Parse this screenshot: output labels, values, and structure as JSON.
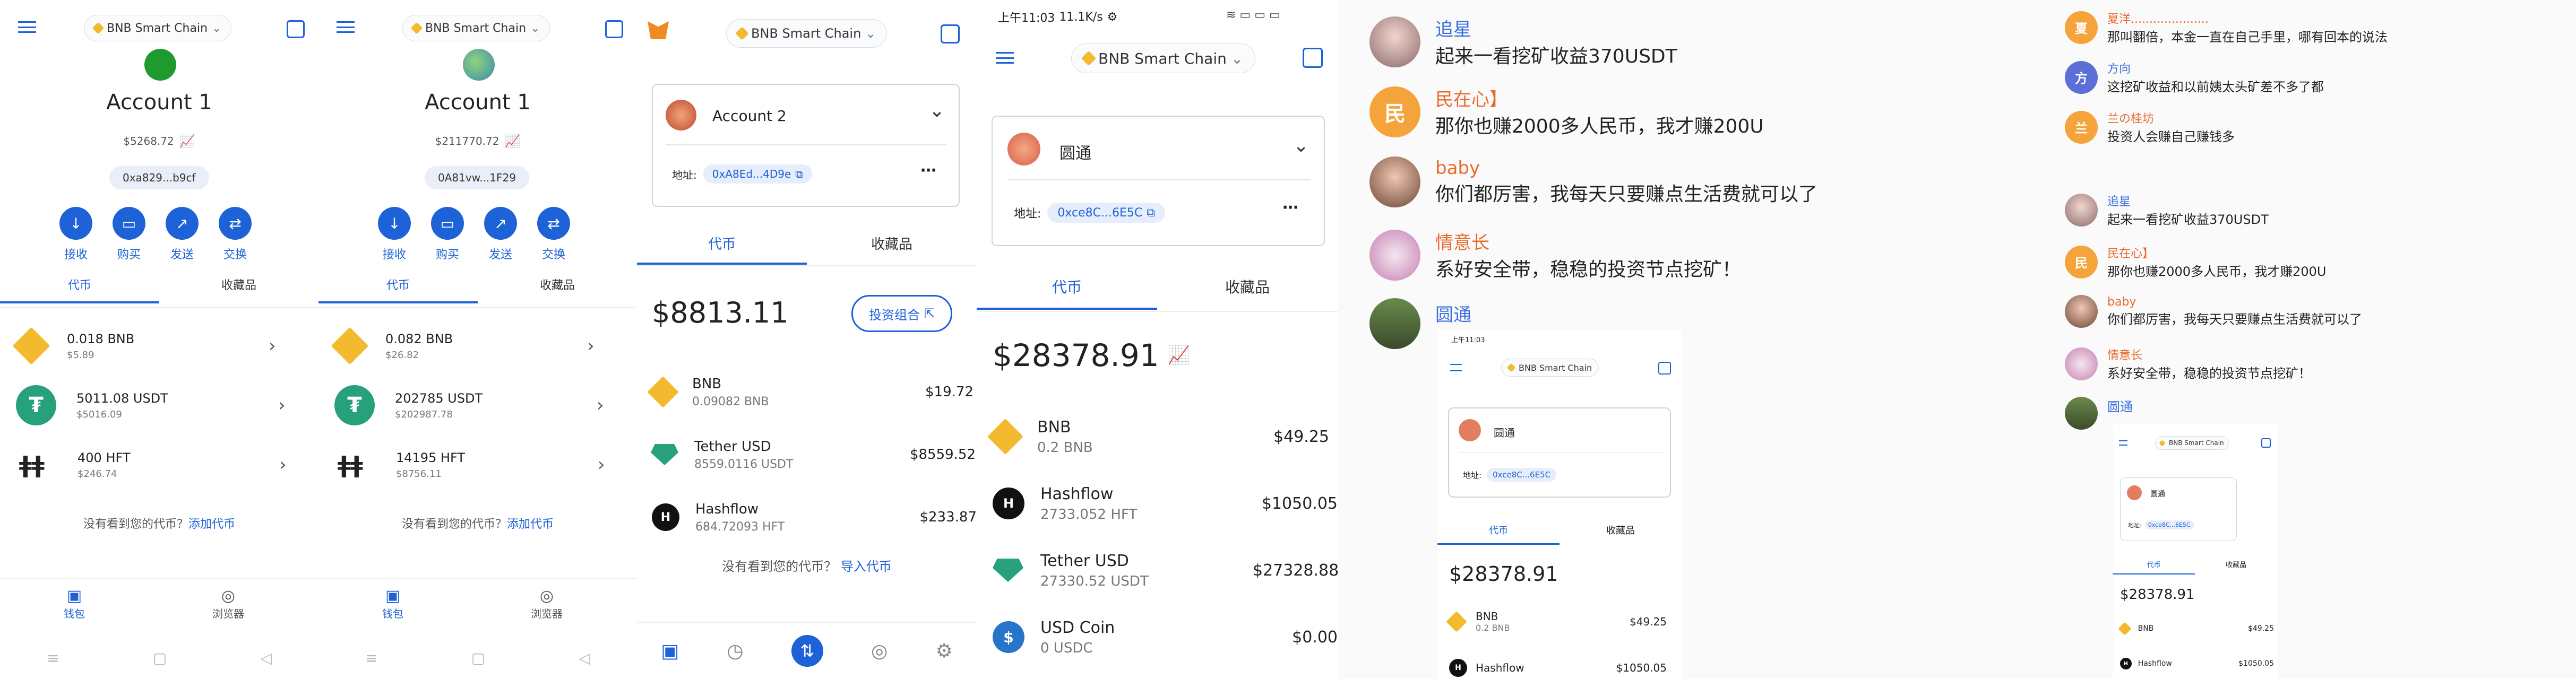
{
  "colors": {
    "accent": "#1d62d6",
    "bnb": "#f3ba2f",
    "tether": "#26a17b",
    "orange": "#f0872a",
    "pink_name": "#e9692c",
    "blue_name": "#3a6fe0"
  },
  "p1": {
    "network": "BNB Smart Chain",
    "account": "Account 1",
    "balance": "$5268.72",
    "address": "0xa829...b9cf",
    "actions": [
      "接收",
      "购买",
      "发送",
      "交换"
    ],
    "tabs": [
      "代币",
      "收藏品"
    ],
    "tokens": [
      {
        "amount": "0.018 BNB",
        "value": "$5.89",
        "icon": "bnb-icon"
      },
      {
        "amount": "5011.08 USDT",
        "value": "$5016.09",
        "icon": "tether-icon"
      },
      {
        "amount": "400 HFT",
        "value": "$246.74",
        "icon": "hashflow-icon"
      }
    ],
    "missing": "没有看到您的代币？",
    "add": "添加代币",
    "nav": [
      "钱包",
      "浏览器"
    ]
  },
  "p2": {
    "network": "BNB Smart Chain",
    "account": "Account 1",
    "balance": "$211770.72",
    "address": "0A81vw...1F29",
    "actions": [
      "接收",
      "购买",
      "发送",
      "交换"
    ],
    "tabs": [
      "代币",
      "收藏品"
    ],
    "tokens": [
      {
        "amount": "0.082 BNB",
        "value": "$26.82",
        "icon": "bnb-icon"
      },
      {
        "amount": "202785 USDT",
        "value": "$202987.78",
        "icon": "tether-icon"
      },
      {
        "amount": "14195 HFT",
        "value": "$8756.11",
        "icon": "hashflow-icon"
      }
    ],
    "missing": "没有看到您的代币？",
    "add": "添加代币",
    "nav": [
      "钱包",
      "浏览器"
    ]
  },
  "p3": {
    "network": "BNB Smart Chain",
    "account": "Account 2",
    "address_label": "地址:",
    "address": "0xA8Ed...4D9e",
    "tabs": [
      "代币",
      "收藏品"
    ],
    "total": "$8813.11",
    "portfolio": "投资组合",
    "tokens": [
      {
        "name": "BNB",
        "amount": "0.09082 BNB",
        "value": "$19.72"
      },
      {
        "name": "Tether USD",
        "amount": "8559.0116 USDT",
        "value": "$8559.52"
      },
      {
        "name": "Hashflow",
        "amount": "684.72093 HFT",
        "value": "$233.87"
      }
    ],
    "missing": "没有看到您的代币？",
    "add": "导入代币"
  },
  "p4": {
    "status_time": "上午11:03",
    "status_speed": "11.1K/s",
    "network": "BNB Smart Chain",
    "account": "圆通",
    "address_label": "地址:",
    "address": "0xce8C...6E5C",
    "tabs": [
      "代币",
      "收藏品"
    ],
    "total": "$28378.91",
    "tokens": [
      {
        "name": "BNB",
        "amount": "0.2 BNB",
        "value": "$49.25"
      },
      {
        "name": "Hashflow",
        "amount": "2733.052 HFT",
        "value": "$1050.05"
      },
      {
        "name": "Tether USD",
        "amount": "27330.52 USDT",
        "value": "$27328.88"
      },
      {
        "name": "USD Coin",
        "amount": "0 USDC",
        "value": "$0.00"
      }
    ]
  },
  "chat1": {
    "messages": [
      {
        "name": "追星",
        "text": "起来一看挖矿收益370USDT"
      },
      {
        "name": "民在心】",
        "text": "那你也赚2000多人民币，我才赚200U",
        "avatar": "民"
      },
      {
        "name": "baby",
        "text": "你们都厉害，我每天只要赚点生活费就可以了"
      },
      {
        "name": "情意长",
        "text": "系好安全带，稳稳的投资节点挖矿！"
      },
      {
        "name": "圆通",
        "text": ""
      }
    ],
    "mini": {
      "status": "上午11:03",
      "network": "BNB Smart Chain",
      "account": "圆通",
      "address_label": "地址:",
      "address": "0xce8C...6E5C",
      "tabs": [
        "代币",
        "收藏品"
      ],
      "total": "$28378.91",
      "tokens": [
        {
          "name": "BNB",
          "amount": "0.2 BNB",
          "value": "$49.25"
        },
        {
          "name": "Hashflow",
          "value": "$1050.05"
        }
      ]
    }
  },
  "chat2": {
    "top": [
      {
        "name": "夏洋.....................",
        "text": "那叫翻倍，本金一直在自己手里，哪有回本的说法",
        "avatar": "夏"
      },
      {
        "name": "方向",
        "text": "这挖矿收益和以前姨太头矿差不多了都",
        "avatar": "方"
      },
      {
        "name": "兰の桂坊",
        "text": "投资人会赚自己赚钱多",
        "avatar": "兰"
      }
    ],
    "messages": [
      {
        "name": "追星",
        "text": "起来一看挖矿收益370USDT"
      },
      {
        "name": "民在心】",
        "text": "那你也赚2000多人民币，我才赚200U",
        "avatar": "民"
      },
      {
        "name": "baby",
        "text": "你们都厉害，我每天只要赚点生活费就可以了"
      },
      {
        "name": "情意长",
        "text": "系好安全带，稳稳的投资节点挖矿！"
      },
      {
        "name": "圆通",
        "text": ""
      }
    ],
    "mini": {
      "network": "BNB Smart Chain",
      "account": "圆通",
      "address_label": "地址:",
      "address": "0xce8C...6E5C",
      "tabs": [
        "代币",
        "收藏品"
      ],
      "total": "$28378.91",
      "tokens": [
        {
          "name": "BNB",
          "value": "$49.25"
        },
        {
          "name": "Hashflow",
          "value": "$1050.05"
        }
      ]
    }
  }
}
